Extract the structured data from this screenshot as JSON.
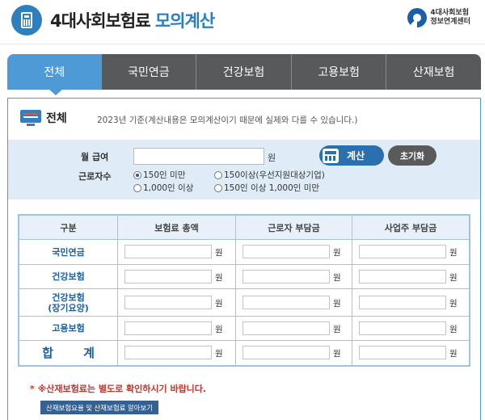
{
  "header": {
    "title_main": "4대사회보험료",
    "title_accent": "모의계산",
    "icon": "calculator-icon",
    "org_logo": {
      "icon": "org-swirl-icon",
      "line1": "4대사회보험",
      "line2": "정보연계센터"
    }
  },
  "tabs": [
    {
      "label": "전체",
      "active": true
    },
    {
      "label": "국민연금",
      "active": false
    },
    {
      "label": "건강보험",
      "active": false
    },
    {
      "label": "고용보험",
      "active": false
    },
    {
      "label": "산재보험",
      "active": false
    }
  ],
  "section": {
    "icon": "monitor-icon",
    "title": "전체",
    "note": "2023년 기준(계산내용은 모의계산이기 때문에 실제와 다를 수 있습니다.)"
  },
  "form": {
    "salary_label": "월 급여",
    "salary_value": "",
    "won": "원",
    "calc_button": "계산",
    "reset_button": "초기화",
    "workers_label": "근로자수",
    "radio_options": [
      {
        "label": "150인 미만",
        "checked": true
      },
      {
        "label": "150이상(우선지원대상기업)",
        "checked": false
      },
      {
        "label": "1,000인 이상",
        "checked": false
      },
      {
        "label": "150인 이상 1,000인 미만",
        "checked": false
      }
    ]
  },
  "table": {
    "headers": [
      "구분",
      "보험료 총액",
      "근로자 부담금",
      "사업주 부담금"
    ],
    "won": "원",
    "rows": [
      {
        "label": "국민연금",
        "values": [
          "",
          "",
          ""
        ]
      },
      {
        "label": "건강보험",
        "values": [
          "",
          "",
          ""
        ]
      },
      {
        "label": "건강보험\n(장기요양)",
        "values": [
          "",
          "",
          ""
        ]
      },
      {
        "label": "고용보험",
        "values": [
          "",
          "",
          ""
        ]
      },
      {
        "label": "합 계",
        "values": [
          "",
          "",
          ""
        ]
      }
    ]
  },
  "notice": "* ※산재보험료는 별도로 확인하시기 바랍니다.",
  "link_button": "산재보험요율 및 산재보험료 알아보기",
  "colors": {
    "accent": "#4d9ad6",
    "tab_bg": "#58595b",
    "input_bg": "#dfecf8",
    "notice": "#c8322a",
    "calc_button": "#2a6fae"
  }
}
